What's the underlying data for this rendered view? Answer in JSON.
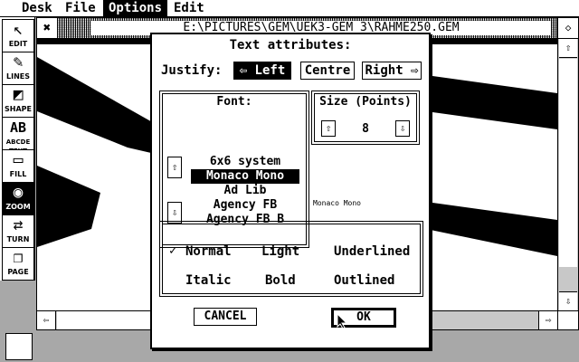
{
  "menubar": {
    "items": [
      {
        "label": "Desk",
        "active": false
      },
      {
        "label": "File",
        "active": false
      },
      {
        "label": "Options",
        "active": true
      },
      {
        "label": "Edit",
        "active": false
      }
    ]
  },
  "toolbar": {
    "tools": [
      {
        "label": "EDIT",
        "icon": "arrow-cursor-icon",
        "glyph": "↖"
      },
      {
        "label": "LINES",
        "icon": "pencil-icon",
        "glyph": "✎"
      },
      {
        "label": "SHAPE",
        "icon": "shape-icon",
        "glyph": "◩"
      },
      {
        "label": "ABCDE TEXT",
        "icon": "text-icon",
        "glyph": "AB"
      },
      {
        "label": "FILL",
        "icon": "paint-roller-icon",
        "glyph": "▭"
      },
      {
        "label": "ZOOM",
        "icon": "magnifier-icon",
        "glyph": "◉"
      },
      {
        "label": "TURN",
        "icon": "rotate-icon",
        "glyph": "⇄"
      },
      {
        "label": "PAGE",
        "icon": "page-icon",
        "glyph": "❐"
      }
    ],
    "selected_index": 5
  },
  "document": {
    "title": "E:\\PICTURES\\GEM\\UEK3-GEM_3\\RAHME250.GEM",
    "close_glyph": "✖",
    "fuller_glyph": "◇",
    "scroll_up_glyph": "⇧",
    "scroll_down_glyph": "⇩",
    "scroll_left_glyph": "⇦",
    "scroll_right_glyph": "⇨"
  },
  "dialog": {
    "title": "Text attributes:",
    "justify_label": "Justify:",
    "justify_options": [
      {
        "label": "⇦ Left",
        "selected": true
      },
      {
        "label": "Centre",
        "selected": false
      },
      {
        "label": "Right ⇨",
        "selected": false
      }
    ],
    "font_label": "Font:",
    "fonts": [
      "6x6 system",
      "Monaco Mono",
      "Ad Lib",
      "Agency FB",
      "Agency FB B"
    ],
    "selected_font_index": 1,
    "font_up_glyph": "⇧",
    "font_down_glyph": "⇩",
    "size_label": "Size (Points)",
    "size_value": "8",
    "size_up_glyph": "⇧",
    "size_down_glyph": "⇩",
    "font_preview": "Monaco Mono",
    "styles": [
      {
        "label": "Normal",
        "checked": true
      },
      {
        "label": "Light",
        "checked": false
      },
      {
        "label": "Underlined",
        "checked": false
      },
      {
        "label": "Italic",
        "checked": false
      },
      {
        "label": "Bold",
        "checked": false
      },
      {
        "label": "Outlined",
        "checked": false
      }
    ],
    "check_glyph": "✓",
    "cancel_label": "CANCEL",
    "ok_label": "OK"
  }
}
